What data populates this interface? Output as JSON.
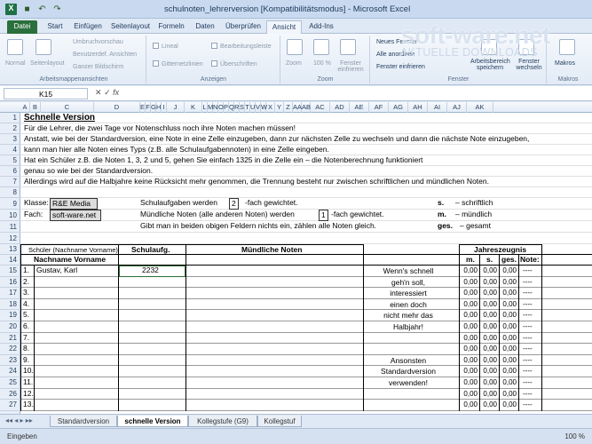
{
  "window": {
    "title": "schulnoten_lehrerversion [Kompatibilitätsmodus] - Microsoft Excel"
  },
  "ribbon": {
    "tabs": [
      "Datei",
      "Start",
      "Einfügen",
      "Seitenlayout",
      "Formeln",
      "Daten",
      "Überprüfen",
      "Ansicht",
      "Add-Ins"
    ],
    "g1": {
      "normal": "Normal",
      "seitenlayout": "Seitenlayout",
      "umbruch": "Umbruchvorschau",
      "benutzer": "Benutzerdef. Ansichten",
      "ganzer": "Ganzer Bildschirm",
      "cap": "Arbeitsmappenansichten"
    },
    "g2": {
      "lineal": "Lineal",
      "bearb": "Bearbeitungsleiste",
      "gitter": "Gitternetzlinien",
      "ueber": "Überschriften",
      "cap": "Anzeigen"
    },
    "g3": {
      "zoom": "Zoom",
      "z100": "100 %",
      "fenster": "Fenster einfrieren",
      "cap": "Zoom"
    },
    "g4": {
      "neues": "Neues Fenster",
      "alle": "Alle anordnen",
      "einfrieren": "Fenster einfrieren",
      "arbeits": "Arbeitsbereich speichern",
      "wechseln": "Fenster wechseln",
      "cap": "Fenster"
    },
    "g5": {
      "makros": "Makros",
      "cap": "Makros"
    }
  },
  "watermark": {
    "brand": "soft-ware.net",
    "sub": "AKTUELLE DOWNLOADS"
  },
  "formula": {
    "namebox": "K15",
    "fx": "fx"
  },
  "columns": [
    "A",
    "B",
    "C",
    "D",
    "E",
    "F",
    "G",
    "H",
    "I",
    "J",
    "K",
    "L",
    "M",
    "N",
    "O",
    "P",
    "Q",
    "R",
    "S",
    "T",
    "U",
    "V",
    "W",
    "X",
    "Y",
    "Z",
    "AA",
    "AB",
    "AC",
    "AD",
    "AE",
    "AF",
    "AG",
    "AH",
    "AI",
    "AJ",
    "AK"
  ],
  "sheet": {
    "r1": "Schnelle Version",
    "r2": "Für die Lehrer, die zwei Tage vor Notenschluss noch ihre Noten machen müssen!",
    "r3": "Anstatt, wie bei der Standardversion, eine Note in eine Zelle einzugeben, dann zur nächsten Zelle zu wechseln und dann die nächste Note einzugeben,",
    "r4": "kann man hier alle Noten eines Typs (z.B. alle Schulaufgabennoten) in eine Zelle eingeben.",
    "r5": "Hat ein Schüler z.B. die Noten 1, 3, 2 und 5, gehen Sie einfach 1325 in die Zelle ein – die Notenberechnung funktioniert",
    "r6": "genau so wie bei der Standardversion.",
    "r7": "Allerdings wird auf die Halbjahre keine Rücksicht mehr genommen, die Trennung besteht nur zwischen schriftlichen und mündlichen Noten.",
    "klasse_label": "Klasse:",
    "klasse_val": "R&E Media",
    "fach_label": "Fach:",
    "fach_val": "soft-ware.net",
    "sa1": "Schulaufgaben werden",
    "sa_n": "2",
    "sa2": "-fach gewichtet.",
    "mn1": "Mündliche Noten (alle anderen Noten) werden",
    "mn_n": "1",
    "mn2": "-fach gewichtet.",
    "r11": "Gibt man in beiden obigen Feldern nichts ein, zählen alle Noten gleich.",
    "leg_s": "s.",
    "leg_s_t": "– schriftlich",
    "leg_m": "m.",
    "leg_m_t": "– mündlich",
    "leg_g": "ges.",
    "leg_g_t": "– gesamt",
    "hdr_schueler": "Schüler (Nachname Vorname)",
    "hdr_schulaufg": "Schulaufg.",
    "hdr_muendl": "Mündliche Noten",
    "hdr_jahres": "Jahreszeugnis",
    "hdr_name": "Nachname Vorname",
    "hdr_m": "m.",
    "hdr_s": "s.",
    "hdr_ges": "ges.",
    "hdr_note": "Note:",
    "note_text": [
      "Wenn's schnell",
      "geh'n soll,",
      "interessiert",
      "einen doch",
      "nicht mehr das",
      "Halbjahr!",
      "",
      "",
      "Ansonsten",
      "Standardversion",
      "verwenden!"
    ],
    "students": [
      {
        "nr": "1.",
        "name": "Gustav, Karl",
        "sa": "2232"
      },
      {
        "nr": "2.",
        "name": "",
        "sa": ""
      },
      {
        "nr": "3.",
        "name": "",
        "sa": ""
      },
      {
        "nr": "4.",
        "name": "",
        "sa": ""
      },
      {
        "nr": "5.",
        "name": "",
        "sa": ""
      },
      {
        "nr": "6.",
        "name": "",
        "sa": ""
      },
      {
        "nr": "7.",
        "name": "",
        "sa": ""
      },
      {
        "nr": "8.",
        "name": "",
        "sa": ""
      },
      {
        "nr": "9.",
        "name": "",
        "sa": ""
      },
      {
        "nr": "10.",
        "name": "",
        "sa": ""
      },
      {
        "nr": "11.",
        "name": "",
        "sa": ""
      },
      {
        "nr": "12.",
        "name": "",
        "sa": ""
      },
      {
        "nr": "13.",
        "name": "",
        "sa": ""
      }
    ],
    "grade_m": "0,00",
    "grade_s": "0,00",
    "grade_ges": "0,00",
    "grade_note": "----"
  },
  "sheettabs": [
    "Standardversion",
    "schnelle Version",
    "Kollegstufe (G9)",
    "Kollegstuf"
  ],
  "status": {
    "left": "Eingeben",
    "zoom": "100 %"
  }
}
